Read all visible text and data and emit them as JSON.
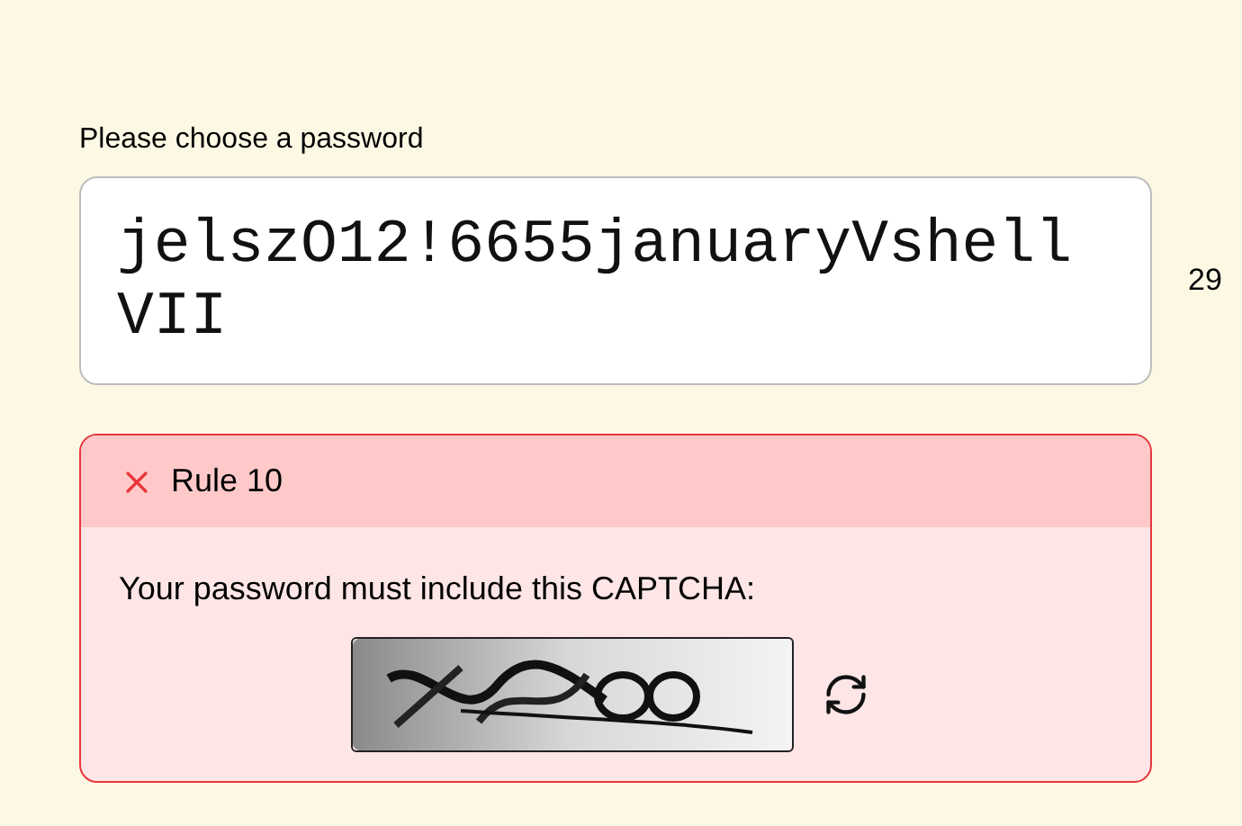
{
  "password_label": "Please choose a password",
  "password": {
    "value": "jelszO12!6655januaryVshellVII"
  },
  "character_count": "29",
  "rules": [
    {
      "title": "Rule 10",
      "passed": false,
      "text": "Your password must include this CAPTCHA:"
    }
  ]
}
